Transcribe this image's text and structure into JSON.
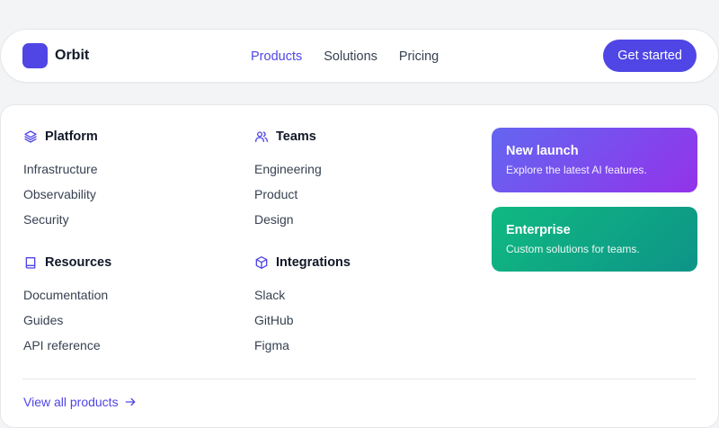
{
  "brand": {
    "name": "Orbit"
  },
  "nav": {
    "links": [
      {
        "label": "Products",
        "active": true
      },
      {
        "label": "Solutions",
        "active": false
      },
      {
        "label": "Pricing",
        "active": false
      }
    ],
    "cta_label": "Get started"
  },
  "menu": {
    "sections": [
      {
        "title": "Platform",
        "icon": "layers-icon",
        "items": [
          "Infrastructure",
          "Observability",
          "Security"
        ]
      },
      {
        "title": "Teams",
        "icon": "users-icon",
        "items": [
          "Engineering",
          "Product",
          "Design"
        ]
      },
      {
        "title": "Resources",
        "icon": "book-icon",
        "items": [
          "Documentation",
          "Guides",
          "API reference"
        ]
      },
      {
        "title": "Integrations",
        "icon": "cube-icon",
        "items": [
          "Slack",
          "GitHub",
          "Figma"
        ]
      }
    ],
    "cards": [
      {
        "title": "New launch",
        "desc": "Explore the latest AI features."
      },
      {
        "title": "Enterprise",
        "desc": "Custom solutions for teams."
      }
    ],
    "view_all_label": "View all products"
  },
  "colors": {
    "accent": "#4f46e5",
    "card_purple": "#7c3aed",
    "card_green": "#10b981"
  }
}
